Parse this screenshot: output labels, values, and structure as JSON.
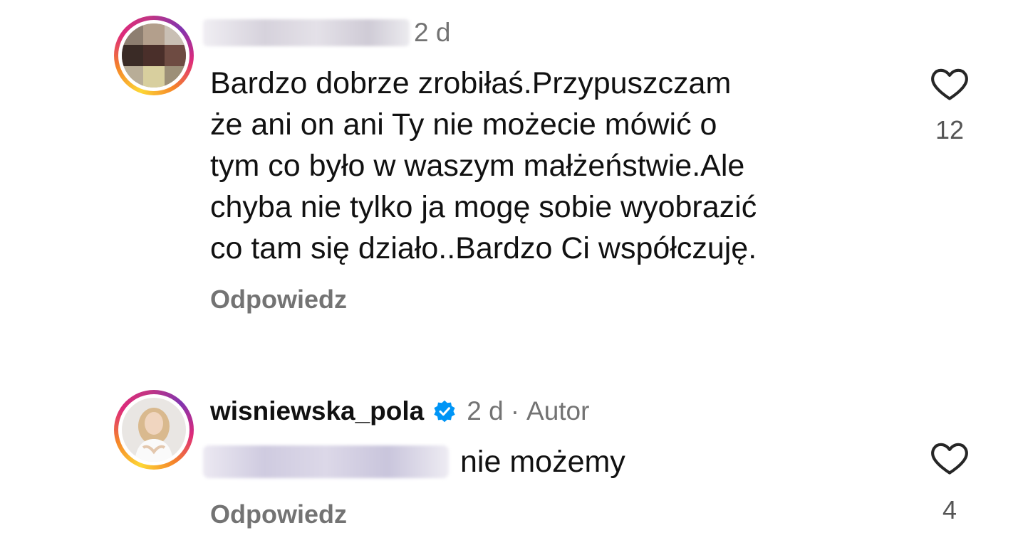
{
  "comments": [
    {
      "username": "",
      "time": "2 d",
      "author_label": "",
      "text": "Bardzo dobrze zrobiłaś.Przypuszczam\nże ani on ani Ty nie możecie mówić o\ntym co było w waszym małżeństwie.Ale\nchyba nie tylko ja mogę sobie wyobrazić\nco tam się działo..Bardzo Ci współczuję.",
      "reply_label": "Odpowiedz",
      "like_count": "12",
      "username_blurred": true
    },
    {
      "username": "wisniewska_pola",
      "verified": true,
      "time": "2 d",
      "separator": "·",
      "author_label": "Autor",
      "text": "nie możemy",
      "reply_label": "Odpowiedz",
      "like_count": "4",
      "mention_blurred": true
    }
  ],
  "icons": {
    "like": "heart-outline-icon",
    "verified": "verified-badge-icon"
  },
  "colors": {
    "text": "#111111",
    "secondary": "#737373",
    "verified": "#0095f6",
    "story_ring_start": "#fdd735",
    "story_ring_end": "#c13584"
  }
}
